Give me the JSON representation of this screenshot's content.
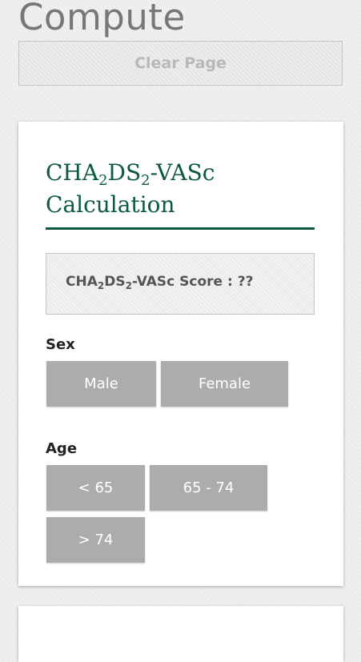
{
  "page": {
    "heading": "Compute",
    "clear_button": "Clear Page"
  },
  "calculator": {
    "title_part1": "CHA",
    "title_sub1": "2",
    "title_part2": "DS",
    "title_sub2": "2",
    "title_part3": "-VASc",
    "title_line2": "Calculation",
    "score": {
      "part1": "CHA",
      "sub1": "2",
      "part2": "DS",
      "sub2": "2",
      "part3": "-VASc Score : ??"
    },
    "sex": {
      "label": "Sex",
      "options": [
        "Male",
        "Female"
      ]
    },
    "age": {
      "label": "Age",
      "options": [
        "< 65",
        "65 - 74",
        "> 74"
      ]
    }
  },
  "colors": {
    "accent": "#0e5a3c",
    "option_button": "#acacac",
    "heading_text": "#777777"
  }
}
